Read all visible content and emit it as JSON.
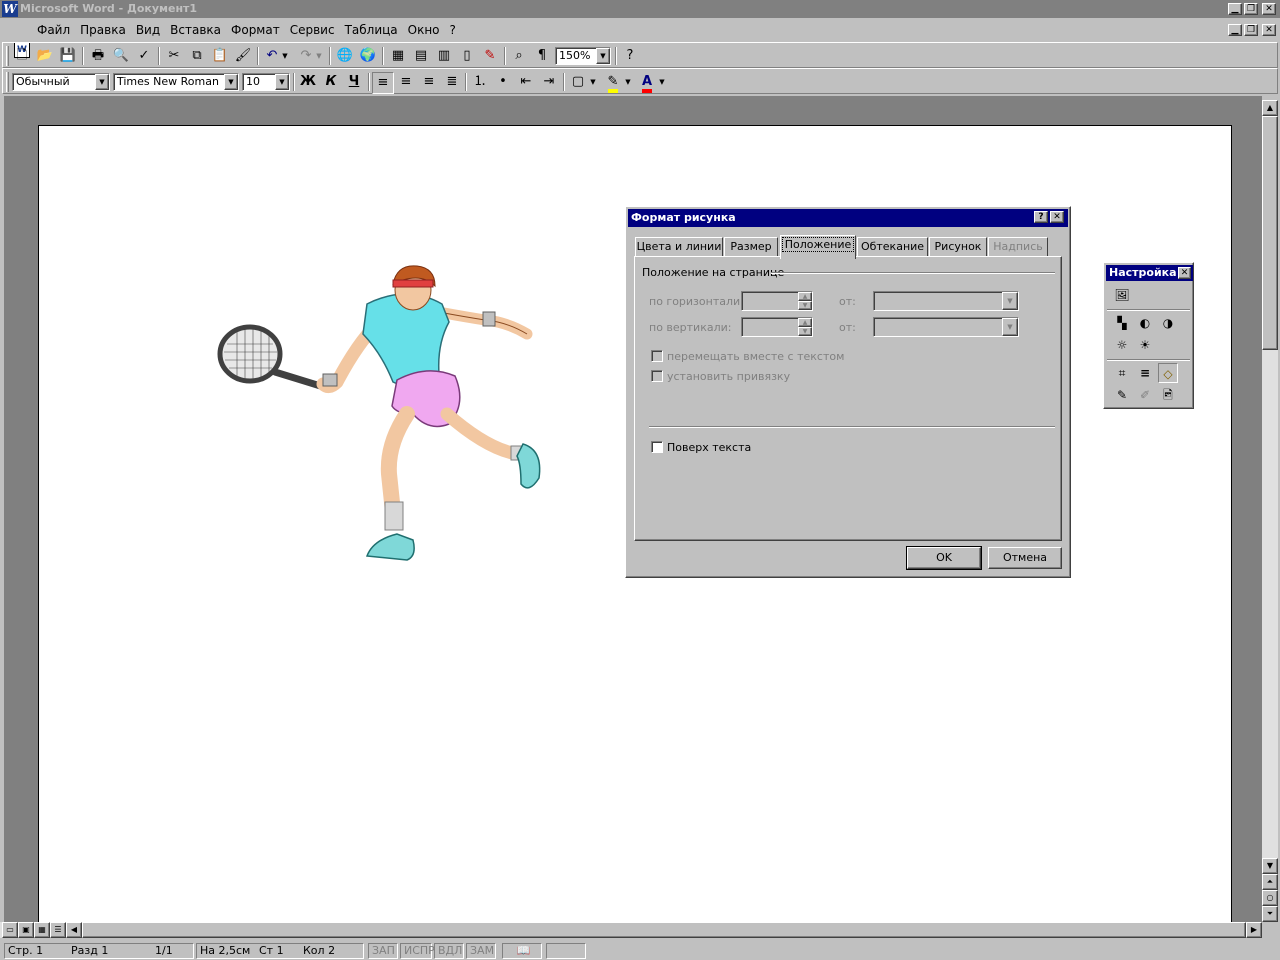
{
  "window": {
    "title": "Microsoft Word - Документ1",
    "app_icon": "W"
  },
  "menu": [
    "Файл",
    "Правка",
    "Вид",
    "Вставка",
    "Формат",
    "Сервис",
    "Таблица",
    "Окно",
    "?"
  ],
  "standard_toolbar": {
    "zoom": "150%"
  },
  "format_toolbar": {
    "style": "Обычный",
    "font": "Times New Roman",
    "size": "10",
    "bold": "Ж",
    "italic": "К",
    "underline": "Ч",
    "font_color_letter": "A"
  },
  "dialog": {
    "title": "Формат рисунка",
    "tabs": [
      "Цвета и линии",
      "Размер",
      "Положение",
      "Обтекание",
      "Рисунок",
      "Надпись"
    ],
    "active_tab": "Положение",
    "group_title": "Положение на странице",
    "horizontal_label": "по горизонтали:",
    "vertical_label": "по вертикали:",
    "from_label": "от:",
    "move_with_text": "перемещать вместе с текстом",
    "lock_anchor": "установить привязку",
    "over_text": "Поверх текста",
    "ok": "OK",
    "cancel": "Отмена"
  },
  "picture_toolbar": {
    "title": "Настройка"
  },
  "status": {
    "page": "Стр. 1",
    "section": "Разд 1",
    "pages": "1/1",
    "at": "На 2,5см",
    "line": "Ст 1",
    "col": "Кол 2",
    "rec": "ЗАП",
    "trk": "ИСПР",
    "ext": "ВДЛ",
    "ovr": "ЗАМ"
  },
  "colors": {
    "title_active": "#000080",
    "title_inactive": "#808080",
    "face": "#c0c0c0",
    "highlight": "#ffff00",
    "font_color": "#ff0000"
  }
}
